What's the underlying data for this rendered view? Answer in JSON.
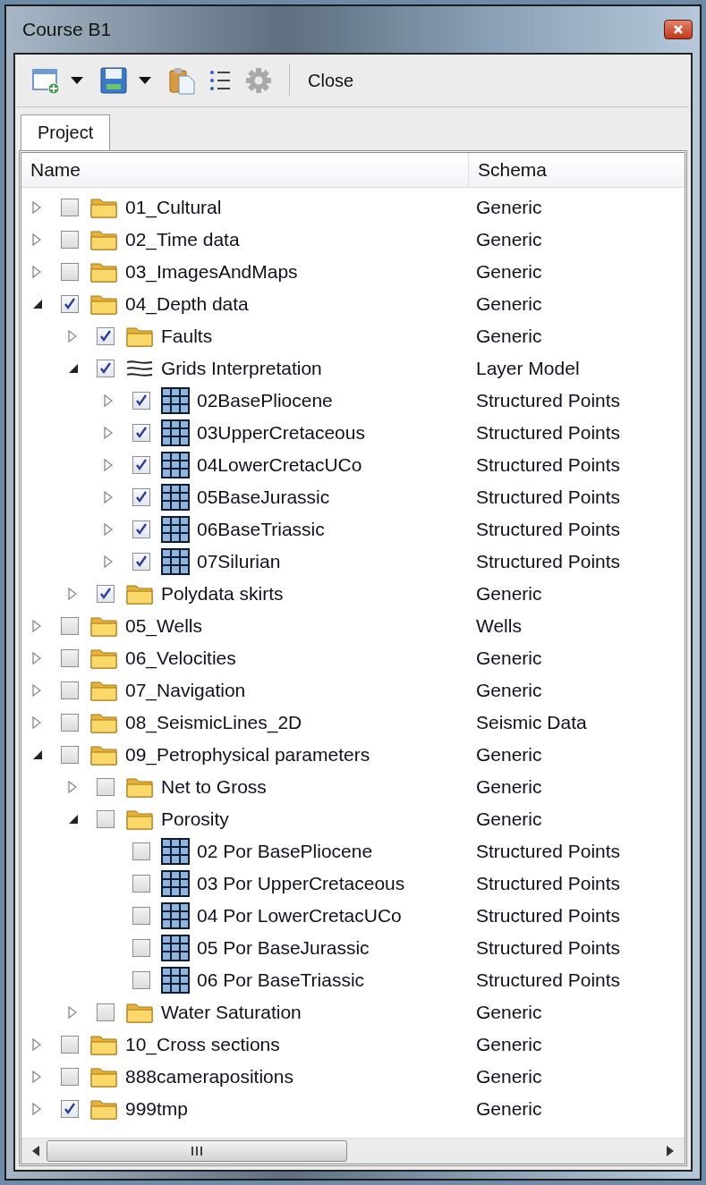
{
  "window": {
    "title": "Course B1"
  },
  "toolbar": {
    "close_label": "Close"
  },
  "tabs": [
    {
      "label": "Project",
      "selected": true
    }
  ],
  "tree": {
    "columns": [
      "Name",
      "Schema"
    ],
    "items": [
      {
        "name": "01_Cultural",
        "schema": "Generic",
        "kind": "folder",
        "checked": false,
        "expanded": false
      },
      {
        "name": "02_Time data",
        "schema": "Generic",
        "kind": "folder",
        "checked": false,
        "expanded": false
      },
      {
        "name": "03_ImagesAndMaps",
        "schema": "Generic",
        "kind": "folder",
        "checked": false,
        "expanded": false
      },
      {
        "name": "04_Depth data",
        "schema": "Generic",
        "kind": "folder",
        "checked": true,
        "expanded": true,
        "children": [
          {
            "name": "Faults",
            "schema": "Generic",
            "kind": "folder",
            "checked": true,
            "expanded": false
          },
          {
            "name": "Grids Interpretation",
            "schema": "Layer Model",
            "kind": "layers",
            "checked": true,
            "expanded": true,
            "children": [
              {
                "name": "02BasePliocene",
                "schema": "Structured Points",
                "kind": "grid",
                "checked": true,
                "expanded": false
              },
              {
                "name": "03UpperCretaceous",
                "schema": "Structured Points",
                "kind": "grid",
                "checked": true,
                "expanded": false
              },
              {
                "name": "04LowerCretacUCo",
                "schema": "Structured Points",
                "kind": "grid",
                "checked": true,
                "expanded": false
              },
              {
                "name": "05BaseJurassic",
                "schema": "Structured Points",
                "kind": "grid",
                "checked": true,
                "expanded": false
              },
              {
                "name": "06BaseTriassic",
                "schema": "Structured Points",
                "kind": "grid",
                "checked": true,
                "expanded": false
              },
              {
                "name": "07Silurian",
                "schema": "Structured Points",
                "kind": "grid",
                "checked": true,
                "expanded": false
              }
            ]
          },
          {
            "name": "Polydata skirts",
            "schema": "Generic",
            "kind": "folder",
            "checked": true,
            "expanded": false
          }
        ]
      },
      {
        "name": "05_Wells",
        "schema": "Wells",
        "kind": "folder",
        "checked": false,
        "expanded": false
      },
      {
        "name": "06_Velocities",
        "schema": "Generic",
        "kind": "folder",
        "checked": false,
        "expanded": false
      },
      {
        "name": "07_Navigation",
        "schema": "Generic",
        "kind": "folder",
        "checked": false,
        "expanded": false
      },
      {
        "name": "08_SeismicLines_2D",
        "schema": "Seismic Data",
        "kind": "folder",
        "checked": false,
        "expanded": false
      },
      {
        "name": "09_Petrophysical parameters",
        "schema": "Generic",
        "kind": "folder",
        "checked": false,
        "expanded": true,
        "children": [
          {
            "name": "Net to Gross",
            "schema": "Generic",
            "kind": "folder",
            "checked": false,
            "expanded": false
          },
          {
            "name": "Porosity",
            "schema": "Generic",
            "kind": "folder",
            "checked": false,
            "expanded": true,
            "children": [
              {
                "name": "02 Por BasePliocene",
                "schema": "Structured Points",
                "kind": "grid",
                "checked": false
              },
              {
                "name": "03 Por UpperCretaceous",
                "schema": "Structured Points",
                "kind": "grid",
                "checked": false
              },
              {
                "name": "04 Por LowerCretacUCo",
                "schema": "Structured Points",
                "kind": "grid",
                "checked": false
              },
              {
                "name": "05 Por BaseJurassic",
                "schema": "Structured Points",
                "kind": "grid",
                "checked": false
              },
              {
                "name": "06 Por BaseTriassic",
                "schema": "Structured Points",
                "kind": "grid",
                "checked": false
              }
            ]
          },
          {
            "name": "Water Saturation",
            "schema": "Generic",
            "kind": "folder",
            "checked": false,
            "expanded": false
          }
        ]
      },
      {
        "name": "10_Cross sections",
        "schema": "Generic",
        "kind": "folder",
        "checked": false,
        "expanded": false
      },
      {
        "name": "888camerapositions",
        "schema": "Generic",
        "kind": "folder",
        "checked": false,
        "expanded": false
      },
      {
        "name": "999tmp",
        "schema": "Generic",
        "kind": "folder",
        "checked": true,
        "expanded": false
      }
    ]
  }
}
